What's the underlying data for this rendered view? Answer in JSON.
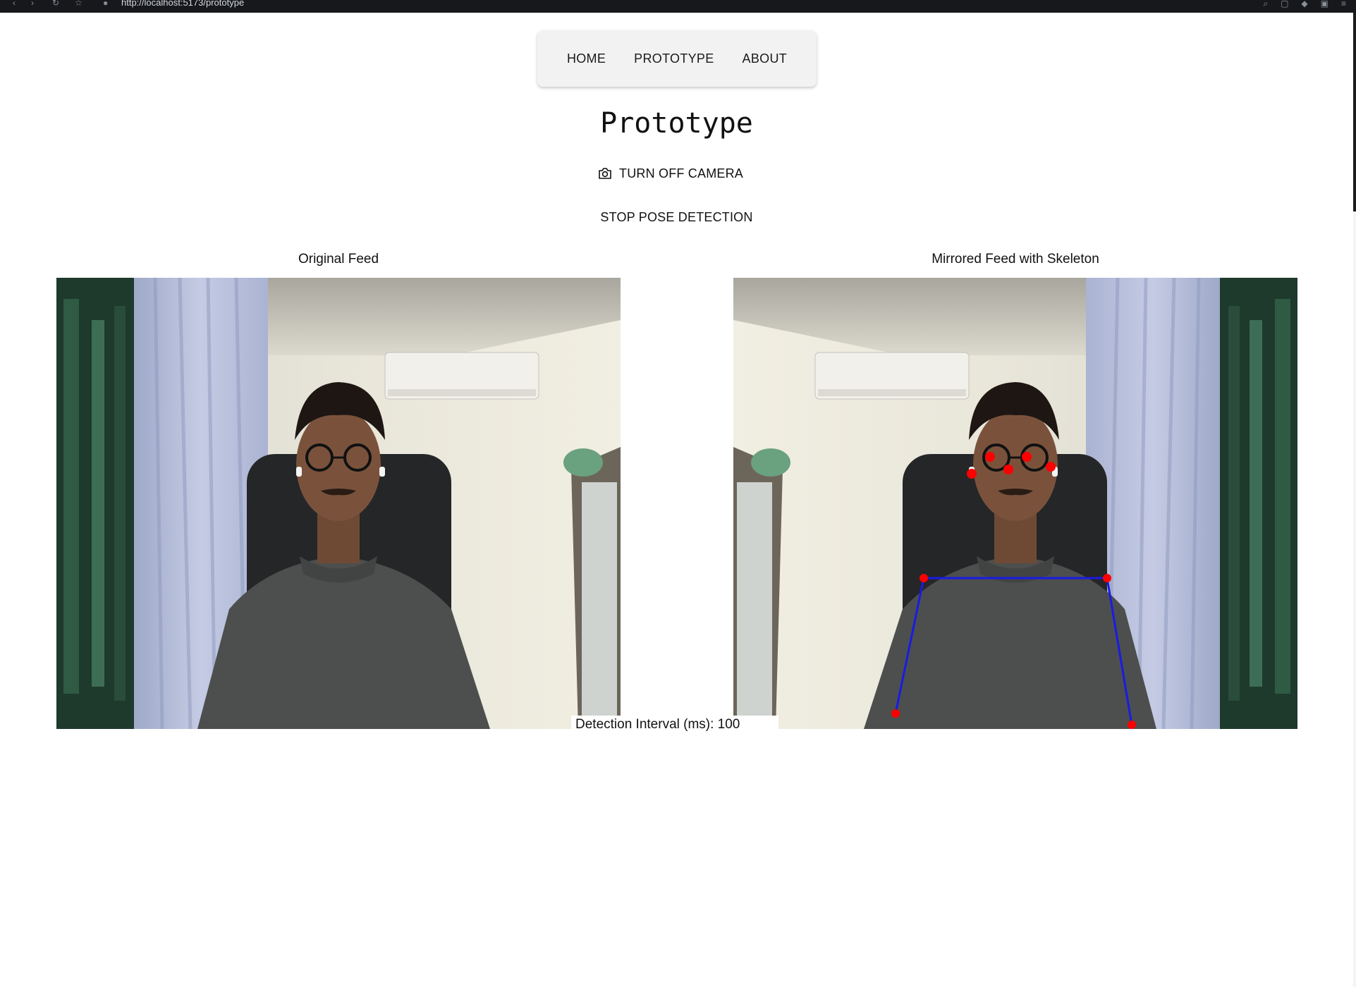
{
  "browser": {
    "url": "http://localhost:5173/prototype"
  },
  "nav": {
    "items": [
      "HOME",
      "PROTOTYPE",
      "ABOUT"
    ]
  },
  "page": {
    "title": "Prototype"
  },
  "controls": {
    "camera_label": "TURN OFF CAMERA",
    "pose_label": "STOP POSE DETECTION"
  },
  "feeds": {
    "original_label": "Original Feed",
    "mirrored_label": "Mirrored Feed with Skeleton"
  },
  "interval": {
    "label": "Detection Interval (ms): 100"
  },
  "colors": {
    "skeleton_line": "#1a1ae6",
    "keypoint": "#ff0000"
  }
}
